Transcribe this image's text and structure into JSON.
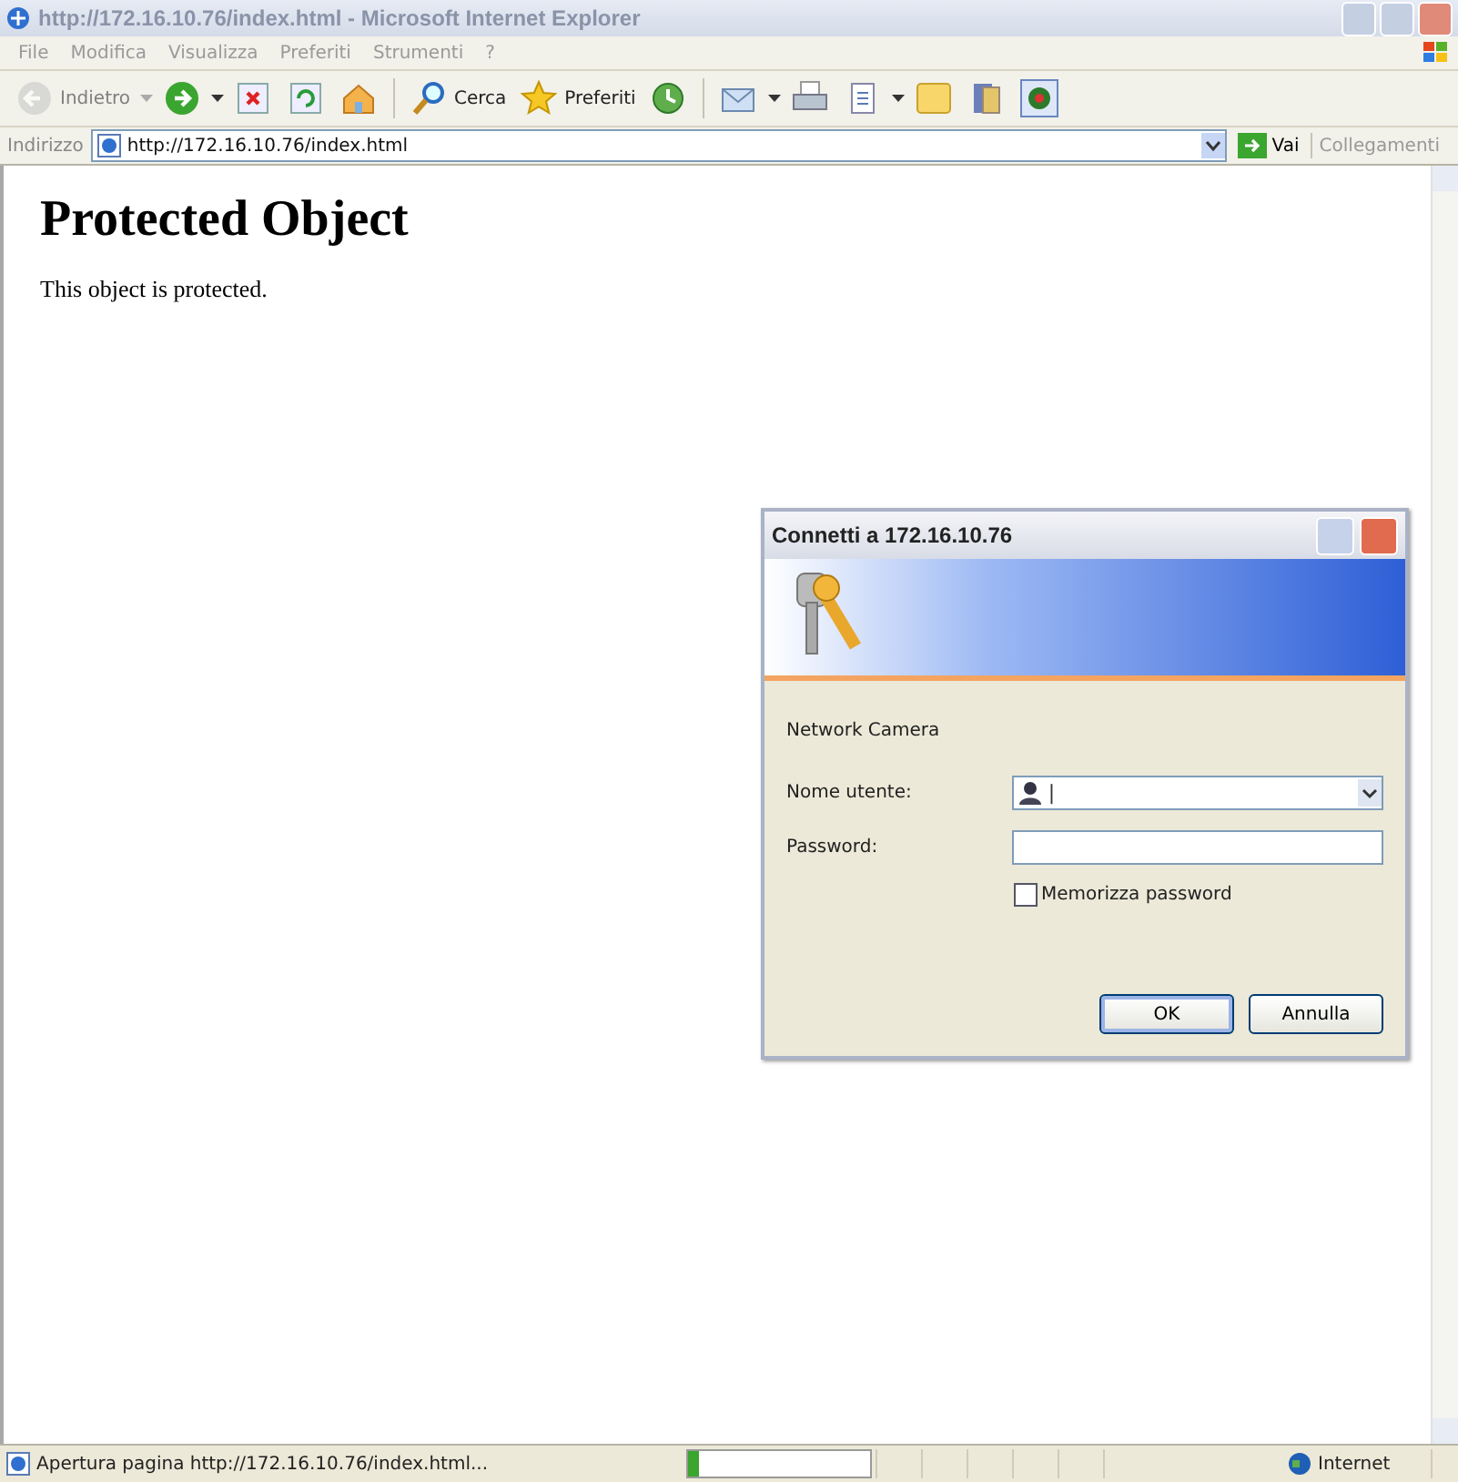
{
  "window": {
    "title": "http://172.16.10.76/index.html - Microsoft Internet Explorer"
  },
  "menu": [
    "File",
    "Modifica",
    "Visualizza",
    "Preferiti",
    "Strumenti",
    "?"
  ],
  "toolbar": [
    {
      "kind": "back",
      "label": "Indietro",
      "disabled": true,
      "dropdown": true
    },
    {
      "kind": "forward",
      "disabled": false,
      "dropdown": true
    },
    {
      "kind": "stop",
      "disabled": false,
      "dropdown": false
    },
    {
      "kind": "refresh",
      "disabled": false,
      "dropdown": false
    },
    {
      "kind": "home",
      "disabled": false,
      "dropdown": false
    },
    {
      "kind": "search",
      "label": "Cerca",
      "disabled": false,
      "dropdown": false
    },
    {
      "kind": "favorites",
      "label": "Preferiti",
      "disabled": false,
      "dropdown": false
    },
    {
      "kind": "history",
      "disabled": false,
      "dropdown": false
    },
    {
      "kind": "mail",
      "disabled": false,
      "dropdown": true
    },
    {
      "kind": "print",
      "disabled": false,
      "dropdown": false
    },
    {
      "kind": "edit",
      "disabled": false,
      "dropdown": true
    },
    {
      "kind": "note",
      "disabled": false,
      "dropdown": false
    },
    {
      "kind": "research",
      "disabled": false,
      "dropdown": false
    },
    {
      "kind": "plugin",
      "disabled": false,
      "dropdown": false
    }
  ],
  "address": {
    "label": "Indirizzo",
    "value": "http://172.16.10.76/index.html",
    "go": "Vai",
    "links": "Collegamenti"
  },
  "page": {
    "heading": "Protected Object",
    "text": "This object is protected."
  },
  "dialog": {
    "title": "Connetti a 172.16.10.76",
    "realm": "Network Camera",
    "fields": [
      {
        "kind": "combo",
        "label": "Nome utente:",
        "value": "|"
      },
      {
        "kind": "password",
        "label": "Password:"
      }
    ],
    "remember": {
      "label": "Memorizza password",
      "checked": false
    },
    "buttons": [
      "OK",
      "Annulla"
    ]
  },
  "status_bar": {
    "text": "Apertura pagina http://172.16.10.76/index.html...",
    "progress": {
      "level": 0.06
    },
    "zone": "Internet"
  }
}
